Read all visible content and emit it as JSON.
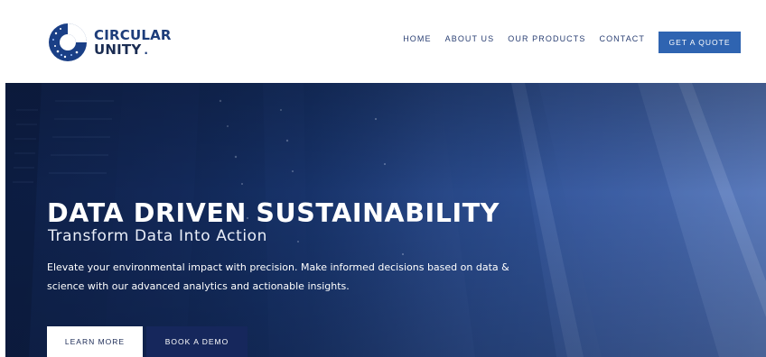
{
  "brand": {
    "name_line1": "CIRCULAR",
    "name_line2": "UNITY",
    "dot": "."
  },
  "nav": {
    "items": [
      {
        "label": "HOME"
      },
      {
        "label": "ABOUT US"
      },
      {
        "label": "OUR PRODUCTS"
      },
      {
        "label": "CONTACT"
      }
    ],
    "cta_label": "GET A QUOTE"
  },
  "hero": {
    "title": "DATA DRIVEN SUSTAINABILITY",
    "subtitle": "Transform Data Into Action",
    "description": "Elevate your environmental impact with precision. Make informed decisions based on data & science with our advanced analytics and actionable insights.",
    "buttons": {
      "learn_more": "LEARN MORE",
      "book_demo": "BOOK A DEMO"
    }
  },
  "colors": {
    "brand_blue": "#1d3d7a",
    "cta_blue": "#2f64b1",
    "hero_dark": "#102350",
    "demo_button": "#16275c"
  },
  "icons": {
    "logo": "circular-logo-icon"
  }
}
